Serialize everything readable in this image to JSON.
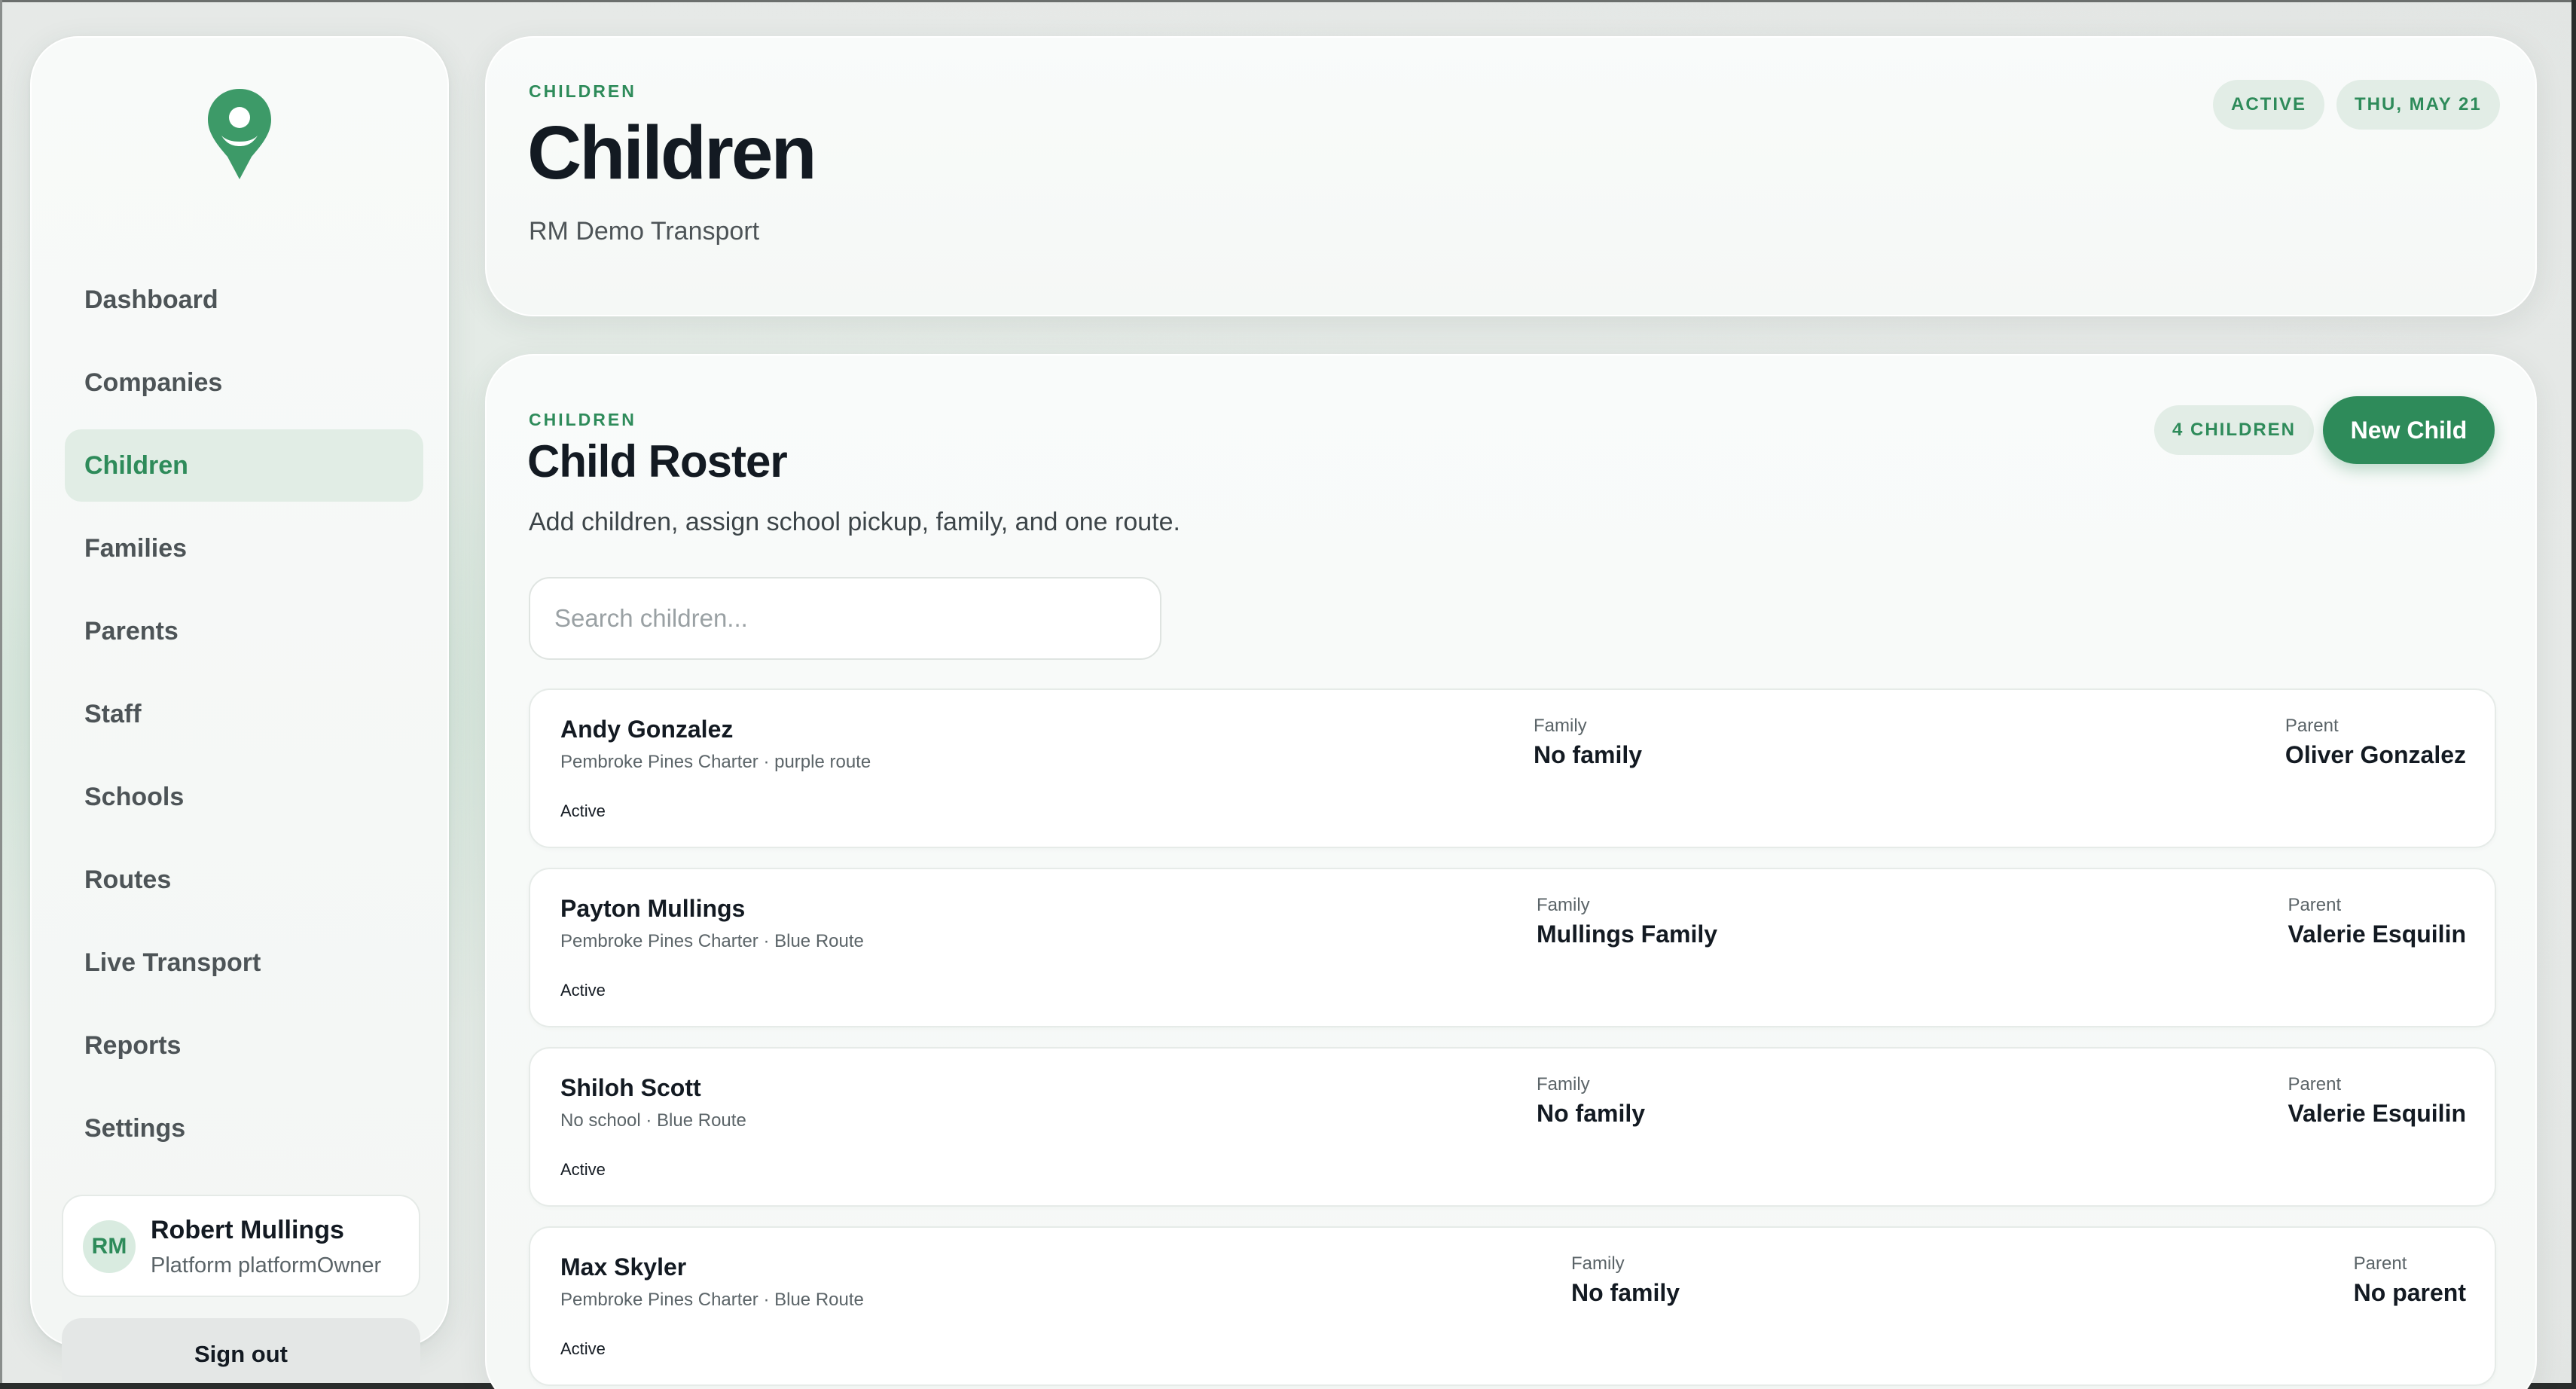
{
  "sidebar": {
    "nav": [
      {
        "label": "Dashboard",
        "active": false
      },
      {
        "label": "Companies",
        "active": false
      },
      {
        "label": "Children",
        "active": true
      },
      {
        "label": "Families",
        "active": false
      },
      {
        "label": "Parents",
        "active": false
      },
      {
        "label": "Staff",
        "active": false
      },
      {
        "label": "Schools",
        "active": false
      },
      {
        "label": "Routes",
        "active": false
      },
      {
        "label": "Live Transport",
        "active": false
      },
      {
        "label": "Reports",
        "active": false
      },
      {
        "label": "Settings",
        "active": false
      }
    ],
    "user": {
      "initials": "RM",
      "name": "Robert Mullings",
      "role": "Platform platformOwner"
    },
    "sign_out": "Sign out"
  },
  "header": {
    "eyebrow": "CHILDREN",
    "title": "Children",
    "subtitle": "RM Demo Transport",
    "status_badge": "ACTIVE",
    "date_badge": "THU, MAY 21"
  },
  "roster": {
    "eyebrow": "CHILDREN",
    "title": "Child Roster",
    "subtitle": "Add children, assign school pickup, family, and one route.",
    "count_badge": "4 CHILDREN",
    "new_button": "New Child",
    "search_placeholder": "Search children...",
    "family_label": "Family",
    "parent_label": "Parent",
    "children": [
      {
        "name": "Andy Gonzalez",
        "meta": "Pembroke Pines Charter · purple route",
        "status": "Active",
        "family": "No family",
        "parent": "Oliver Gonzalez"
      },
      {
        "name": "Payton Mullings",
        "meta": "Pembroke Pines Charter · Blue Route",
        "status": "Active",
        "family": "Mullings Family",
        "parent": "Valerie Esquilin"
      },
      {
        "name": "Shiloh Scott",
        "meta": "No school · Blue Route",
        "status": "Active",
        "family": "No family",
        "parent": "Valerie Esquilin"
      },
      {
        "name": "Max Skyler",
        "meta": "Pembroke Pines Charter · Blue Route",
        "status": "Active",
        "family": "No family",
        "parent": "No parent"
      }
    ]
  },
  "colors": {
    "accent": "#2e8b5a",
    "accent_soft": "#e2ede6",
    "text": "#131a22",
    "muted": "#5b6468"
  }
}
